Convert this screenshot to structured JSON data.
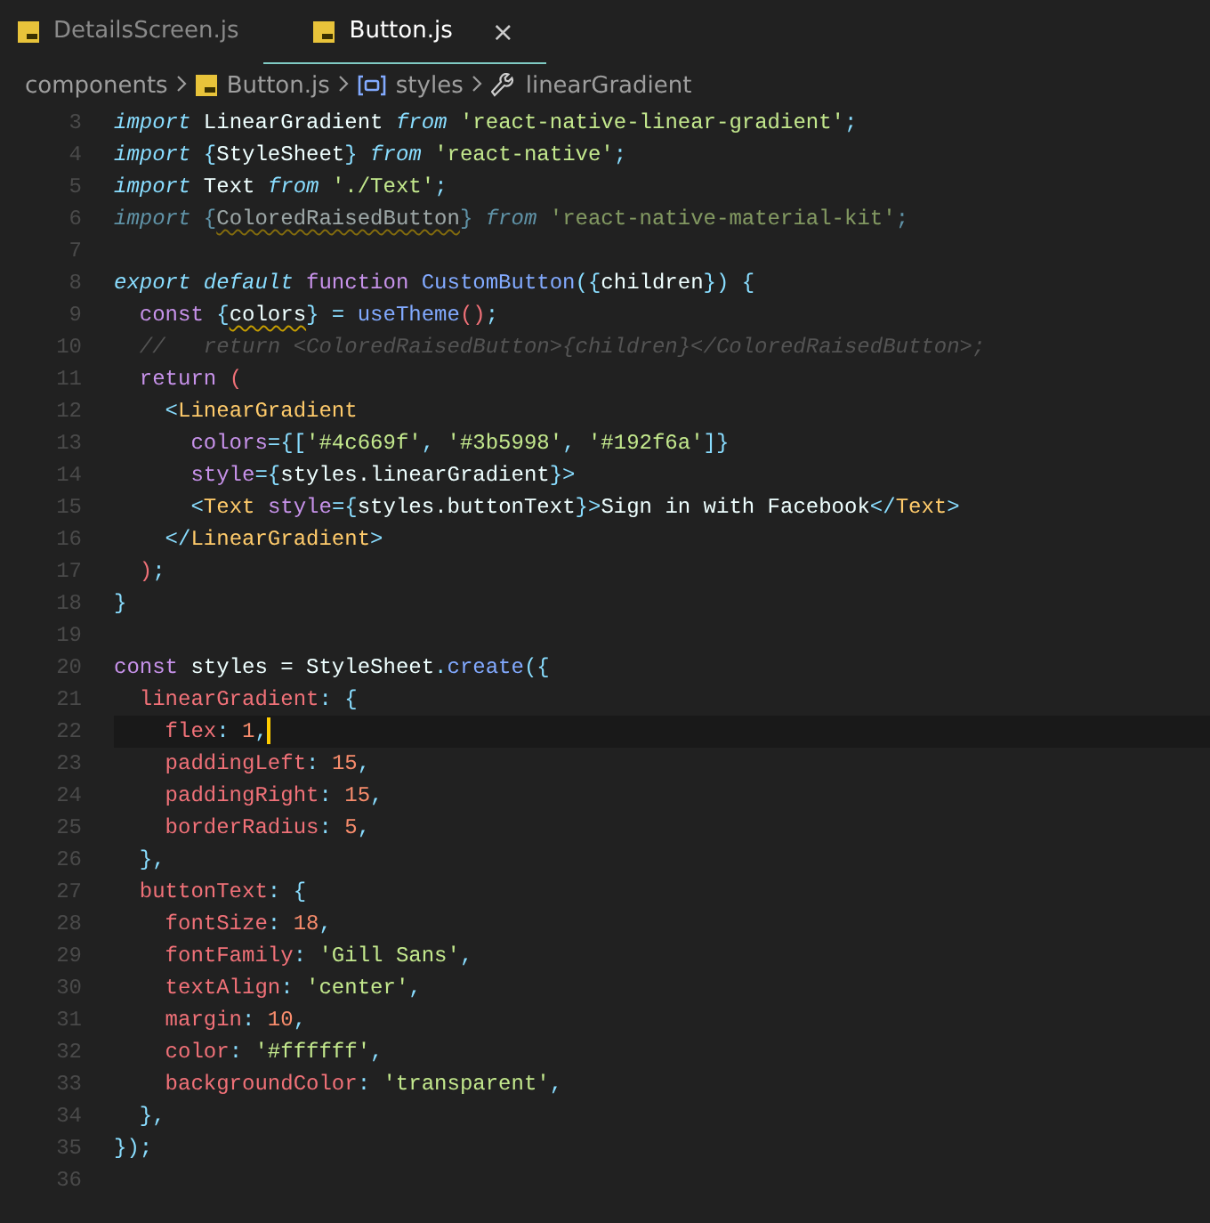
{
  "tabs": [
    {
      "label": "DetailsScreen.js",
      "selected": false
    },
    {
      "label": "Button.js",
      "selected": true,
      "close": "×"
    }
  ],
  "breadcrumbs": [
    {
      "kind": "folder",
      "label": "components"
    },
    {
      "kind": "file",
      "label": "Button.js"
    },
    {
      "kind": "variable",
      "label": "styles"
    },
    {
      "kind": "property",
      "label": "linearGradient"
    }
  ],
  "lines": [
    {
      "number": "3",
      "tokens": [
        {
          "kind": "kw",
          "text": "import "
        },
        {
          "kind": "plain",
          "text": "LinearGradient "
        },
        {
          "kind": "kw",
          "text": "from "
        },
        {
          "kind": "string",
          "text": "'react-native-linear-gradient'"
        },
        {
          "kind": "punct",
          "text": ";"
        }
      ]
    },
    {
      "number": "4",
      "tokens": [
        {
          "kind": "kw",
          "text": "import "
        },
        {
          "kind": "punct",
          "text": "{"
        },
        {
          "kind": "plain",
          "text": "StyleSheet"
        },
        {
          "kind": "punct",
          "text": "} "
        },
        {
          "kind": "kw",
          "text": "from "
        },
        {
          "kind": "string",
          "text": "'react-native'"
        },
        {
          "kind": "punct",
          "text": ";"
        }
      ]
    },
    {
      "number": "5",
      "tokens": [
        {
          "kind": "kw",
          "text": "import "
        },
        {
          "kind": "plain",
          "text": "Text "
        },
        {
          "kind": "kw",
          "text": "from "
        },
        {
          "kind": "string",
          "text": "'./Text'"
        },
        {
          "kind": "punct",
          "text": ";"
        }
      ]
    },
    {
      "number": "6",
      "faded": true,
      "tokens": [
        {
          "kind": "kw",
          "text": "import "
        },
        {
          "kind": "punct",
          "text": "{"
        },
        {
          "kind": "plain",
          "text": "ColoredRaisedButton",
          "warning": true
        },
        {
          "kind": "punct",
          "text": "} "
        },
        {
          "kind": "kw",
          "text": "from "
        },
        {
          "kind": "string",
          "text": "'react-native-material-kit'"
        },
        {
          "kind": "punct",
          "text": ";"
        }
      ]
    },
    {
      "number": "7"
    },
    {
      "number": "8",
      "tokens": [
        {
          "kind": "kw",
          "text": "export default "
        },
        {
          "kind": "storage",
          "text": "function "
        },
        {
          "kind": "func",
          "text": "CustomButton"
        },
        {
          "kind": "punct",
          "text": "({"
        },
        {
          "kind": "plain",
          "text": "children"
        },
        {
          "kind": "punct",
          "text": "}) {"
        }
      ]
    },
    {
      "number": "9",
      "tokens": [
        {
          "kind": "storage",
          "text": "  const "
        },
        {
          "kind": "punct",
          "text": "{"
        },
        {
          "kind": "plain",
          "text": "colors",
          "warning": true
        },
        {
          "kind": "punct",
          "text": "} = "
        },
        {
          "kind": "func",
          "text": "useTheme"
        },
        {
          "kind": "paren",
          "text": "()"
        },
        {
          "kind": "punct",
          "text": ";"
        }
      ]
    },
    {
      "number": "10",
      "tokens": [
        {
          "kind": "comment",
          "text": "  //   return <ColoredRaisedButton>{children}</ColoredRaisedButton>;"
        }
      ]
    },
    {
      "number": "11",
      "tokens": [
        {
          "kind": "storage",
          "text": "  return "
        },
        {
          "kind": "paren",
          "text": "("
        }
      ]
    },
    {
      "number": "12",
      "tokens": [
        {
          "kind": "punct",
          "text": "    <"
        },
        {
          "kind": "tag",
          "text": "LinearGradient"
        }
      ]
    },
    {
      "number": "13",
      "tokens": [
        {
          "kind": "attr",
          "text": "      colors"
        },
        {
          "kind": "punct",
          "text": "={["
        },
        {
          "kind": "string",
          "text": "'#4c669f'"
        },
        {
          "kind": "punct",
          "text": ", "
        },
        {
          "kind": "string",
          "text": "'#3b5998'"
        },
        {
          "kind": "punct",
          "text": ", "
        },
        {
          "kind": "string",
          "text": "'#192f6a'"
        },
        {
          "kind": "punct",
          "text": "]}"
        }
      ]
    },
    {
      "number": "14",
      "tokens": [
        {
          "kind": "attr",
          "text": "      style"
        },
        {
          "kind": "punct",
          "text": "={"
        },
        {
          "kind": "plain",
          "text": "styles.linearGradient"
        },
        {
          "kind": "punct",
          "text": "}>"
        }
      ]
    },
    {
      "number": "15",
      "tokens": [
        {
          "kind": "punct",
          "text": "      <"
        },
        {
          "kind": "tag",
          "text": "Text "
        },
        {
          "kind": "attr",
          "text": "style"
        },
        {
          "kind": "punct",
          "text": "={"
        },
        {
          "kind": "plain",
          "text": "styles.buttonText"
        },
        {
          "kind": "punct",
          "text": "}>"
        },
        {
          "kind": "plain",
          "text": "Sign in with Facebook"
        },
        {
          "kind": "punct",
          "text": "</"
        },
        {
          "kind": "tag",
          "text": "Text"
        },
        {
          "kind": "punct",
          "text": ">"
        }
      ]
    },
    {
      "number": "16",
      "tokens": [
        {
          "kind": "punct",
          "text": "    </"
        },
        {
          "kind": "tag",
          "text": "LinearGradient"
        },
        {
          "kind": "punct",
          "text": ">"
        }
      ]
    },
    {
      "number": "17",
      "tokens": [
        {
          "kind": "paren",
          "text": "  )"
        },
        {
          "kind": "punct",
          "text": ";"
        }
      ]
    },
    {
      "number": "18",
      "tokens": [
        {
          "kind": "punct",
          "text": "}"
        }
      ]
    },
    {
      "number": "19"
    },
    {
      "number": "20",
      "tokens": [
        {
          "kind": "storage",
          "text": "const "
        },
        {
          "kind": "plain",
          "text": "styles = StyleSheet"
        },
        {
          "kind": "punct",
          "text": "."
        },
        {
          "kind": "func",
          "text": "create"
        },
        {
          "kind": "punct",
          "text": "({"
        }
      ]
    },
    {
      "number": "21",
      "tokens": [
        {
          "kind": "prop",
          "text": "  linearGradient"
        },
        {
          "kind": "punct",
          "text": ": {"
        }
      ]
    },
    {
      "number": "22",
      "current": true,
      "tokens": [
        {
          "kind": "prop",
          "text": "    flex"
        },
        {
          "kind": "punct",
          "text": ": "
        },
        {
          "kind": "num",
          "text": "1"
        },
        {
          "kind": "punct",
          "text": ","
        }
      ]
    },
    {
      "number": "23",
      "tokens": [
        {
          "kind": "prop",
          "text": "    paddingLeft"
        },
        {
          "kind": "punct",
          "text": ": "
        },
        {
          "kind": "num",
          "text": "15"
        },
        {
          "kind": "punct",
          "text": ","
        }
      ]
    },
    {
      "number": "24",
      "tokens": [
        {
          "kind": "prop",
          "text": "    paddingRight"
        },
        {
          "kind": "punct",
          "text": ": "
        },
        {
          "kind": "num",
          "text": "15"
        },
        {
          "kind": "punct",
          "text": ","
        }
      ]
    },
    {
      "number": "25",
      "tokens": [
        {
          "kind": "prop",
          "text": "    borderRadius"
        },
        {
          "kind": "punct",
          "text": ": "
        },
        {
          "kind": "num",
          "text": "5"
        },
        {
          "kind": "punct",
          "text": ","
        }
      ]
    },
    {
      "number": "26",
      "tokens": [
        {
          "kind": "punct",
          "text": "  },"
        }
      ]
    },
    {
      "number": "27",
      "tokens": [
        {
          "kind": "prop",
          "text": "  buttonText"
        },
        {
          "kind": "punct",
          "text": ": {"
        }
      ]
    },
    {
      "number": "28",
      "tokens": [
        {
          "kind": "prop",
          "text": "    fontSize"
        },
        {
          "kind": "punct",
          "text": ": "
        },
        {
          "kind": "num",
          "text": "18"
        },
        {
          "kind": "punct",
          "text": ","
        }
      ]
    },
    {
      "number": "29",
      "tokens": [
        {
          "kind": "prop",
          "text": "    fontFamily"
        },
        {
          "kind": "punct",
          "text": ": "
        },
        {
          "kind": "string",
          "text": "'Gill Sans'"
        },
        {
          "kind": "punct",
          "text": ","
        }
      ]
    },
    {
      "number": "30",
      "tokens": [
        {
          "kind": "prop",
          "text": "    textAlign"
        },
        {
          "kind": "punct",
          "text": ": "
        },
        {
          "kind": "string",
          "text": "'center'"
        },
        {
          "kind": "punct",
          "text": ","
        }
      ]
    },
    {
      "number": "31",
      "tokens": [
        {
          "kind": "prop",
          "text": "    margin"
        },
        {
          "kind": "punct",
          "text": ": "
        },
        {
          "kind": "num",
          "text": "10"
        },
        {
          "kind": "punct",
          "text": ","
        }
      ]
    },
    {
      "number": "32",
      "tokens": [
        {
          "kind": "prop",
          "text": "    color"
        },
        {
          "kind": "punct",
          "text": ": "
        },
        {
          "kind": "string",
          "text": "'#ffffff'"
        },
        {
          "kind": "punct",
          "text": ","
        }
      ]
    },
    {
      "number": "33",
      "tokens": [
        {
          "kind": "prop",
          "text": "    backgroundColor"
        },
        {
          "kind": "punct",
          "text": ": "
        },
        {
          "kind": "string",
          "text": "'transparent'"
        },
        {
          "kind": "punct",
          "text": ","
        }
      ]
    },
    {
      "number": "34",
      "tokens": [
        {
          "kind": "punct",
          "text": "  },"
        }
      ]
    },
    {
      "number": "35",
      "tokens": [
        {
          "kind": "punct",
          "text": "});"
        }
      ]
    },
    {
      "number": "36"
    }
  ]
}
